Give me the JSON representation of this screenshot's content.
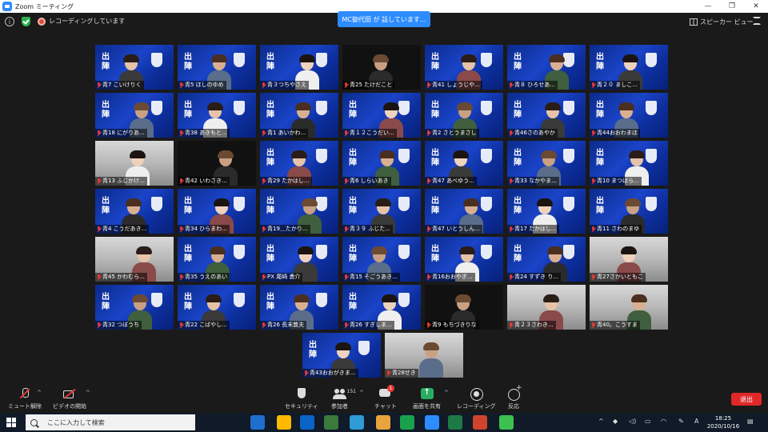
{
  "window": {
    "title": "Zoom ミーティング",
    "controls": [
      "—",
      "❐",
      "✕"
    ]
  },
  "meeting": {
    "recording_status": "レコーディングしています",
    "speaking_banner": "MC御代田 が 話しています...",
    "view_mode": "スピーカー ビュー"
  },
  "participants": [
    {
      "name": "青7 こいけりく",
      "style": "normal"
    },
    {
      "name": "青5 ほしのゆめ",
      "style": "normal"
    },
    {
      "name": "青３つちやさえ",
      "style": "normal"
    },
    {
      "name": "青25 たけだこと",
      "style": "dark"
    },
    {
      "name": "青41 しょうじや...",
      "style": "normal"
    },
    {
      "name": "青８ ひろせあ...",
      "style": "normal"
    },
    {
      "name": "青２０ ましこ...",
      "style": "normal"
    },
    {
      "name": "青18 にがりあ...",
      "style": "normal"
    },
    {
      "name": "青38 あきもと...",
      "style": "normal"
    },
    {
      "name": "青1 あいかわ...",
      "style": "normal"
    },
    {
      "name": "青１２こうだい...",
      "style": "normal"
    },
    {
      "name": "青2 さとうまさし",
      "style": "normal"
    },
    {
      "name": "青46さのあやか",
      "style": "normal"
    },
    {
      "name": "青44おおわまほ",
      "style": "normal"
    },
    {
      "name": "青13 ふじかけ...",
      "style": "office"
    },
    {
      "name": "青42 いわさき...",
      "style": "dark"
    },
    {
      "name": "青29 たかはし...",
      "style": "normal"
    },
    {
      "name": "青6 しらいあき",
      "style": "normal"
    },
    {
      "name": "青47 あべゆう...",
      "style": "normal"
    },
    {
      "name": "青33 なかやま...",
      "style": "normal"
    },
    {
      "name": "青10 まつばら...",
      "style": "normal"
    },
    {
      "name": "青4 こうだあき...",
      "style": "normal"
    },
    {
      "name": "青34 ひらまわ...",
      "style": "normal"
    },
    {
      "name": "青19＿たかり...",
      "style": "normal"
    },
    {
      "name": "青３９ ふじた...",
      "style": "normal"
    },
    {
      "name": "青47 いとうしん...",
      "style": "normal"
    },
    {
      "name": "青17 たかはし...",
      "style": "normal"
    },
    {
      "name": "青11 さわのまゆ",
      "style": "normal"
    },
    {
      "name": "青45 かわむら...",
      "style": "office"
    },
    {
      "name": "青35 うえのあい",
      "style": "normal"
    },
    {
      "name": "PX 尾崎 勇介",
      "style": "normal"
    },
    {
      "name": "青15 そごうあき...",
      "style": "normal"
    },
    {
      "name": "青16おおやぎ...",
      "style": "normal"
    },
    {
      "name": "青24 すずき り...",
      "style": "normal"
    },
    {
      "name": "青27さかいともこ",
      "style": "office"
    },
    {
      "name": "青32 つぼうち",
      "style": "normal"
    },
    {
      "name": "青22 こばやし...",
      "style": "normal"
    },
    {
      "name": "青26 長末敦夫",
      "style": "normal"
    },
    {
      "name": "青26 すぎしま...",
      "style": "normal"
    },
    {
      "name": "青9 もちづきりな",
      "style": "dark"
    },
    {
      "name": "青２３さわき...",
      "style": "office"
    },
    {
      "name": "青40。こうすま",
      "style": "office"
    },
    {
      "name": "青43おおがきま...",
      "style": "normal"
    },
    {
      "name": "青28せき",
      "style": "office"
    }
  ],
  "tile_bg_text": "出陣",
  "toolbar": {
    "mute": "ミュート解除",
    "video": "ビデオの開始",
    "security": "セキュリティ",
    "participants": "参加者",
    "participants_count": "151",
    "chat": "チャット",
    "chat_badge": "1",
    "share": "画面を共有",
    "record": "レコーディング",
    "reactions": "反応",
    "leave": "退出"
  },
  "taskbar": {
    "search_placeholder": "ここに入力して検索",
    "time": "18:25",
    "date": "2020/10/16",
    "ime": "A",
    "app_colors": [
      "#1f6fd1",
      "#ffb900",
      "#0a64c8",
      "#3a7a3a",
      "#2e9bd6",
      "#e8a33d",
      "#1aa14b",
      "#2d8cff",
      "#1d7a45",
      "#d0442b",
      "#3cc14e"
    ]
  }
}
